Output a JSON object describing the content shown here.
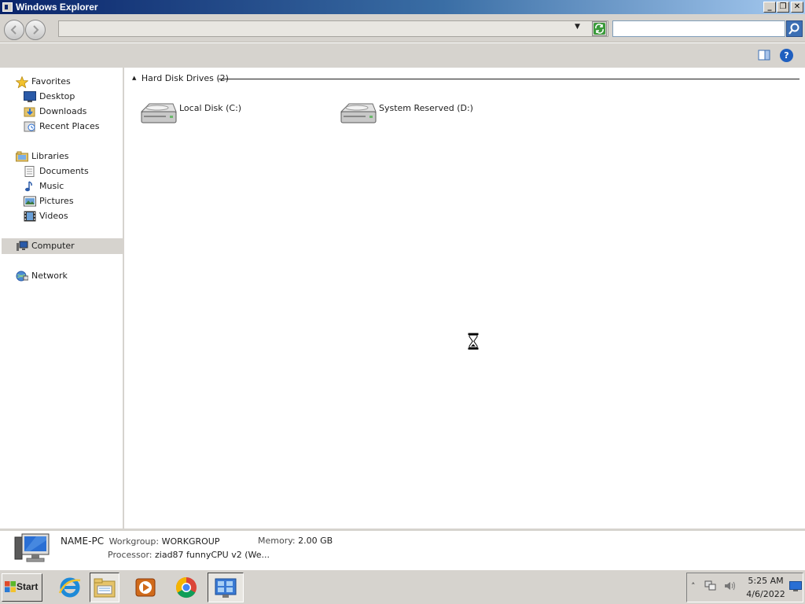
{
  "window": {
    "title": "Windows Explorer",
    "caption_buttons": [
      "minimize",
      "restore",
      "close"
    ]
  },
  "navbar": {
    "address_value": "",
    "search_placeholder": ""
  },
  "nav_pane": {
    "favorites": {
      "label": "Favorites",
      "items": [
        {
          "label": "Desktop",
          "icon": "desktop-icon"
        },
        {
          "label": "Downloads",
          "icon": "downloads-icon"
        },
        {
          "label": "Recent Places",
          "icon": "recent-places-icon"
        }
      ]
    },
    "libraries": {
      "label": "Libraries",
      "items": [
        {
          "label": "Documents",
          "icon": "documents-icon"
        },
        {
          "label": "Music",
          "icon": "music-icon"
        },
        {
          "label": "Pictures",
          "icon": "pictures-icon"
        },
        {
          "label": "Videos",
          "icon": "videos-icon"
        }
      ]
    },
    "computer": {
      "label": "Computer",
      "selected": true
    },
    "network": {
      "label": "Network"
    }
  },
  "content": {
    "group_header": "Hard Disk Drives (2)",
    "drives": [
      {
        "label": "Local Disk (C:)",
        "icon": "hard-drive-icon"
      },
      {
        "label": "System Reserved (D:)",
        "icon": "hard-drive-icon"
      }
    ],
    "cursor": "hourglass-icon"
  },
  "details": {
    "computer_name": "NAME-PC",
    "workgroup_label": "Workgroup:",
    "workgroup_value": "WORKGROUP",
    "memory_label": "Memory:",
    "memory_value": "2.00 GB",
    "processor_label": "Processor:",
    "processor_value": "ziad87 funnyCPU v2 (We..."
  },
  "taskbar": {
    "start_label": "Start",
    "pinned": [
      "internet-explorer-icon",
      "windows-explorer-icon",
      "media-player-icon",
      "chrome-icon",
      "control-panel-icon"
    ],
    "active": "windows-explorer-icon",
    "clock_time": "5:25 AM",
    "clock_date": "4/6/2022"
  },
  "colors": {
    "title_gradient_start": "#0a246a",
    "title_gradient_end": "#a6caf0",
    "chrome_gray": "#d6d3ce",
    "help_blue": "#1f5fbf"
  }
}
